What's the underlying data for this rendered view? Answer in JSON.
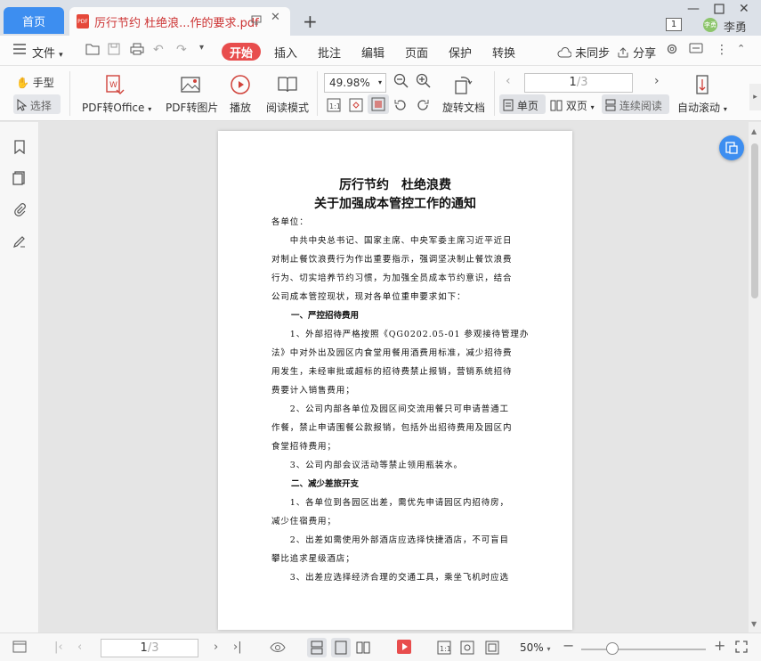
{
  "titlebar": {
    "home_tab": "首页",
    "doc_tab": "厉行节约 杜绝浪...作的要求.pdf",
    "pdf_badge": "PDF",
    "page_count_badge": "1",
    "avatar_text": "李勇",
    "user_name": "李勇"
  },
  "menubar": {
    "file": "文件",
    "tabs": [
      "开始",
      "插入",
      "批注",
      "编辑",
      "页面",
      "保护",
      "转换"
    ],
    "sync": "未同步",
    "share": "分享"
  },
  "ribbon": {
    "hand": "手型",
    "select": "选择",
    "pdf_to_office": "PDF转Office",
    "pdf_to_image": "PDF转图片",
    "play": "播放",
    "read_mode": "阅读模式",
    "zoom": "49.98%",
    "rotate": "旋转文档",
    "page_current": "1",
    "page_total": "/3",
    "single": "单页",
    "double": "双页",
    "continuous": "连续阅读",
    "autoscroll": "自动滚动"
  },
  "document": {
    "title1": "厉行节约　杜绝浪费",
    "title2": "关于加强成本管控工作的通知",
    "lines": [
      "各单位：",
      "　　中共中央总书记、国家主席、中央军委主席习近平近日",
      "对制止餐饮浪费行为作出重要指示，强调坚决制止餐饮浪费",
      "行为、切实培养节约习惯，为加强全员成本节约意识，结合",
      "公司成本管控现状，现对各单位重申要求如下：",
      "　　1、外部招待严格按照《QG0202.05-01 参观接待管理办",
      "法》中对外出及园区内食堂用餐用酒费用标准，减少招待费",
      "用发生，未经审批或超标的招待费禁止报销，营销系统招待",
      "费要计入销售费用；",
      "　　2、公司内部各单位及园区间交流用餐只可申请普通工",
      "作餐，禁止申请围餐公款报销，包括外出招待费用及园区内",
      "食堂招待费用；",
      "　　3、公司内部会议活动等禁止领用瓶装水。",
      "　　1、各单位到各园区出差，需优先申请园区内招待房，",
      "减少住宿费用；",
      "　　2、出差如需使用外部酒店应选择快捷酒店，不可盲目",
      "攀比追求星级酒店；",
      "　　3、出差应选择经济合理的交通工具，乘坐飞机时应选"
    ],
    "heading1": "一、严控招待费用",
    "heading2": "二、减少差旅开支"
  },
  "statusbar": {
    "page_current": "1",
    "page_total": "/3",
    "zoom": "50%"
  },
  "colors": {
    "accent_blue": "#3d8ef0",
    "accent_red": "#e84d4d"
  }
}
